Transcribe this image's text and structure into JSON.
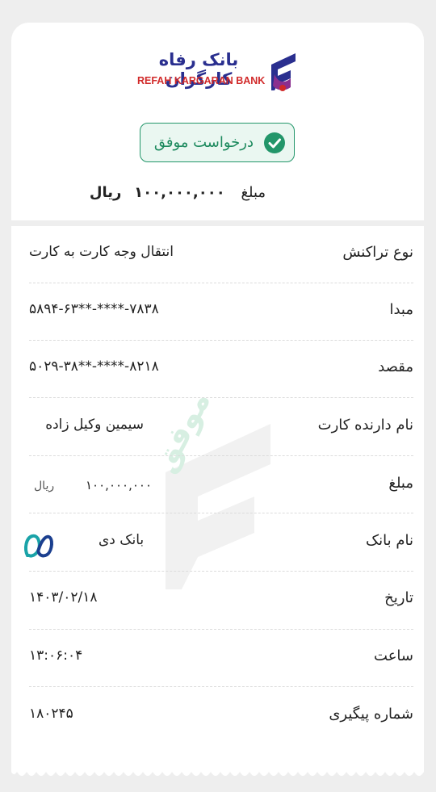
{
  "header": {
    "bank_name_fa": "بانک رفاه کارگران",
    "bank_name_en": "REFAH KARGARAN BANK",
    "status_label": "درخواست موفق",
    "amount_label": "مبلغ",
    "amount_value": "۱۰۰,۰۰۰,۰۰۰",
    "amount_currency": "ریال"
  },
  "watermark": {
    "text": "موفق"
  },
  "details": [
    {
      "label": "نوع تراکنش",
      "value": "انتقال وجه کارت به کارت"
    },
    {
      "label": "مبدا",
      "value": "۵۸۹۴-۶۳**-****-۷۸۳۸"
    },
    {
      "label": "مقصد",
      "value": "۵۰۲۹-۳۸**-****-۸۲۱۸"
    },
    {
      "label": "نام دارنده کارت",
      "value": "سیمین  وکیل زاده"
    },
    {
      "label": "مبلغ",
      "value": "۱۰۰,۰۰۰,۰۰۰",
      "currency": "ریال"
    },
    {
      "label": "نام بانک",
      "value": "بانک دی"
    },
    {
      "label": "تاریخ",
      "value": "۱۴۰۳/۰۲/۱۸"
    },
    {
      "label": "ساعت",
      "value": "۱۳:۰۶:۰۴"
    },
    {
      "label": "شماره پیگیری",
      "value": "۱۸۰۲۴۵"
    }
  ],
  "colors": {
    "success": "#23966a",
    "brand_blue": "#2a2f8f",
    "brand_red": "#d12a2a",
    "brand_purple": "#8b2f8f",
    "dey_teal": "#1aa3a8"
  }
}
